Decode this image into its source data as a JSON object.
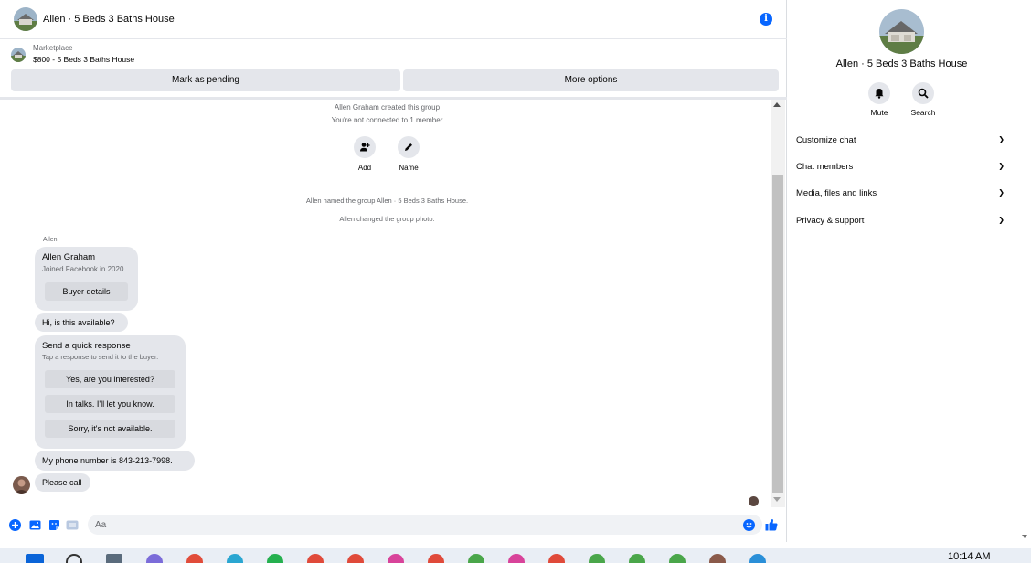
{
  "header": {
    "title": "Allen · 5 Beds 3 Baths House",
    "info_icon": "i"
  },
  "marketplace": {
    "label": "Marketplace",
    "listing": "$800 - 5 Beds 3 Baths House",
    "mark_pending": "Mark as pending",
    "more_options": "More options"
  },
  "thread": {
    "created": "Allen Graham created this group",
    "not_connected": "You're not connected to 1 member",
    "add_label": "Add",
    "name_label": "Name",
    "named_group": "Allen named the group Allen · 5 Beds 3 Baths House.",
    "changed_photo": "Allen changed the group photo.",
    "sender": "Allen",
    "profile_card": {
      "name": "Allen Graham",
      "joined": "Joined Facebook in 2020",
      "button": "Buyer details"
    },
    "msg_available": "Hi, is this available?",
    "quick_response": {
      "title": "Send a quick response",
      "subtitle": "Tap a response to send it to the buyer.",
      "options": [
        "Yes, are you interested?",
        "In talks. I'll let you know.",
        "Sorry, it's not available."
      ]
    },
    "msg_phone": "My phone number is 843-213-7998.",
    "msg_call": "Please call"
  },
  "composer": {
    "placeholder": "Aa"
  },
  "info_panel": {
    "title": "Allen · 5 Beds 3 Baths House",
    "mute_label": "Mute",
    "search_label": "Search",
    "rows": [
      "Customize chat",
      "Chat members",
      "Media, files and links",
      "Privacy & support"
    ]
  },
  "taskbar": {
    "clock": "10:14 AM"
  },
  "colors": {
    "accent": "#0866ff",
    "bubble": "#e4e6eb"
  }
}
